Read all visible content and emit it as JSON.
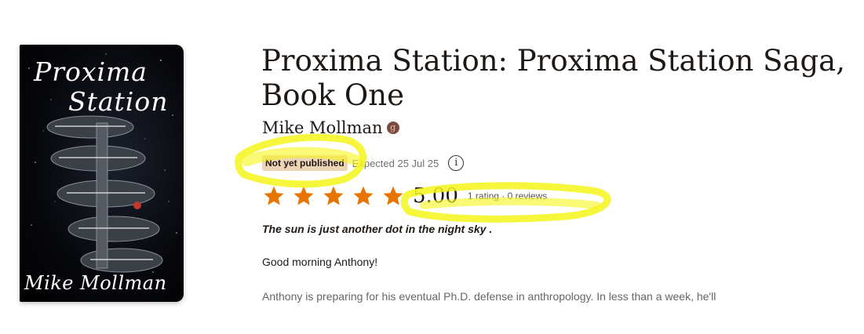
{
  "cover": {
    "title_line1": "Proxima",
    "title_line2": "Station",
    "author": "Mike Mollman"
  },
  "book": {
    "title": "Proxima Station: Proxima Station Saga, Book One",
    "author": "Mike Mollman",
    "status": "Not yet published",
    "expected": "Expected 25 Jul 25",
    "info_icon": "info-icon",
    "rating": {
      "stars_filled": 5,
      "value": "5.00",
      "meta": "1 rating · 0 reviews",
      "star_color": "#e87400"
    },
    "description": {
      "p1": "The sun is just another dot in the night sky .",
      "p2": "Good morning Anthony!",
      "p3": "Anthony is preparing for his eventual Ph.D. defense in anthropology. In less than a week, he'll"
    }
  },
  "highlight_color": "#f5f51a"
}
